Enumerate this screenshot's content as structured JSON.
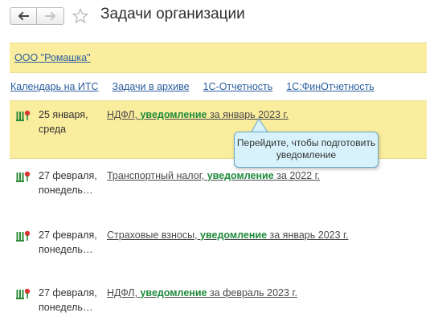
{
  "window": {
    "title": "Задачи организации"
  },
  "organization": {
    "name": "ООО \"Ромашка\""
  },
  "links": [
    {
      "label": "Календарь на ИТС"
    },
    {
      "label": "Задачи в архиве"
    },
    {
      "label": "1С-Отчетность"
    },
    {
      "label": "1С:ФинОтчетность"
    }
  ],
  "tasks": [
    {
      "date": "25 января, среда",
      "desc_before": "НДФЛ, ",
      "desc_highlight": "уведомление",
      "desc_after": " за январь 2023 г."
    },
    {
      "date": "27 февраля, понедель…",
      "desc_before": "Транспортный налог, ",
      "desc_highlight": "уведомление",
      "desc_after": " за 2022 г."
    },
    {
      "date": "27 февраля, понедель…",
      "desc_before": "Страховые взносы, ",
      "desc_highlight": "уведомление",
      "desc_after": " за январь 2023 г."
    },
    {
      "date": "27 февраля, понедель…",
      "desc_before": "НДФЛ, ",
      "desc_highlight": "уведомление",
      "desc_after": " за февраль 2023 г."
    }
  ],
  "tooltip": {
    "text": "Перейдите, чтобы подготовить уведомление"
  },
  "icons": {
    "back": "arrow-left-icon",
    "forward": "arrow-right-icon",
    "favorite": "star-icon",
    "task": "calendar-task-icon"
  },
  "colors": {
    "highlight_bg": "#fbed9e",
    "link": "#2a5e9e",
    "accent_green": "#1e8a3c",
    "tooltip_bg": "#d7f2fb"
  }
}
